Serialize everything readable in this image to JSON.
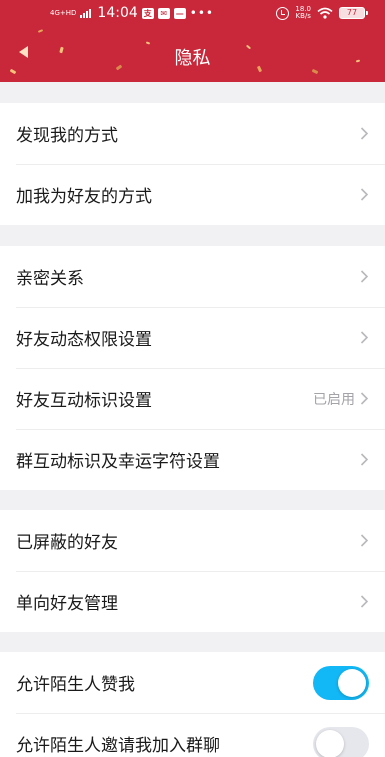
{
  "status_bar": {
    "network": "4G+HD",
    "time": "14:04",
    "app_icons": [
      "支",
      "✉",
      "—"
    ],
    "more": "•••",
    "speed_value": "18.0",
    "speed_unit": "KB/s",
    "battery": "77"
  },
  "header": {
    "title": "隐私",
    "bg_color": "#c8283a"
  },
  "groups": [
    {
      "rows": [
        {
          "label": "发现我的方式",
          "type": "chevron"
        },
        {
          "label": "加我为好友的方式",
          "type": "chevron"
        }
      ]
    },
    {
      "rows": [
        {
          "label": "亲密关系",
          "type": "chevron"
        },
        {
          "label": "好友动态权限设置",
          "type": "chevron"
        },
        {
          "label": "好友互动标识设置",
          "type": "chevron",
          "value": "已启用"
        },
        {
          "label": "群互动标识及幸运字符设置",
          "type": "chevron"
        }
      ]
    },
    {
      "rows": [
        {
          "label": "已屏蔽的好友",
          "type": "chevron"
        },
        {
          "label": "单向好友管理",
          "type": "chevron"
        }
      ]
    },
    {
      "rows": [
        {
          "label": "允许陌生人赞我",
          "type": "toggle",
          "on": true
        },
        {
          "label": "允许陌生人邀请我加入群聊",
          "type": "toggle",
          "on": false
        }
      ]
    }
  ],
  "colors": {
    "toggle_on": "#12b7f5",
    "toggle_off": "#e6e7ec"
  }
}
